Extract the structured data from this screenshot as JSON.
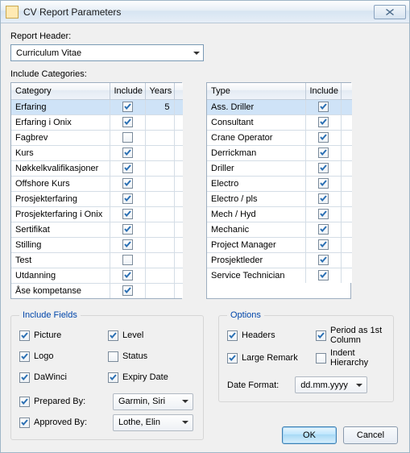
{
  "window": {
    "title": "CV Report Parameters"
  },
  "header": {
    "label": "Report Header:",
    "value": "Curriculum Vitae",
    "categories_label": "Include Categories:"
  },
  "left_table": {
    "cols": {
      "category": "Category",
      "include": "Include",
      "years": "Years"
    },
    "rows": [
      {
        "name": "Erfaring",
        "include": true,
        "years": "5",
        "selected": true
      },
      {
        "name": "Erfaring i Onix",
        "include": true,
        "years": ""
      },
      {
        "name": "Fagbrev",
        "include": false,
        "years": ""
      },
      {
        "name": "Kurs",
        "include": true,
        "years": ""
      },
      {
        "name": "Nøkkelkvalifikasjoner",
        "include": true,
        "years": ""
      },
      {
        "name": "Offshore Kurs",
        "include": true,
        "years": ""
      },
      {
        "name": "Prosjekterfaring",
        "include": true,
        "years": ""
      },
      {
        "name": "Prosjekterfaring i Onix",
        "include": true,
        "years": ""
      },
      {
        "name": "Sertifikat",
        "include": true,
        "years": ""
      },
      {
        "name": "Stilling",
        "include": true,
        "years": ""
      },
      {
        "name": "Test",
        "include": false,
        "years": ""
      },
      {
        "name": "Utdanning",
        "include": true,
        "years": ""
      },
      {
        "name": "Åse kompetanse",
        "include": true,
        "years": ""
      }
    ]
  },
  "right_table": {
    "cols": {
      "type": "Type",
      "include": "Include"
    },
    "rows": [
      {
        "name": "Ass. Driller",
        "include": true,
        "selected": true
      },
      {
        "name": "Consultant",
        "include": true
      },
      {
        "name": "Crane Operator",
        "include": true
      },
      {
        "name": "Derrickman",
        "include": true
      },
      {
        "name": "Driller",
        "include": true
      },
      {
        "name": "Electro",
        "include": true
      },
      {
        "name": "Electro / pls",
        "include": true
      },
      {
        "name": "Mech / Hyd",
        "include": true
      },
      {
        "name": "Mechanic",
        "include": true
      },
      {
        "name": "Project Manager",
        "include": true
      },
      {
        "name": "Prosjektleder",
        "include": true
      },
      {
        "name": "Service Technician",
        "include": true
      }
    ]
  },
  "fields": {
    "legend": "Include Fields",
    "items": {
      "picture": {
        "label": "Picture",
        "checked": true
      },
      "level": {
        "label": "Level",
        "checked": true
      },
      "logo": {
        "label": "Logo",
        "checked": true
      },
      "status": {
        "label": "Status",
        "checked": false
      },
      "dawinci": {
        "label": "DaWinci",
        "checked": true
      },
      "expiry": {
        "label": "Expiry Date",
        "checked": true
      },
      "prepared": {
        "label": "Prepared By:",
        "checked": true,
        "value": "Garmin, Siri"
      },
      "approved": {
        "label": "Approved By:",
        "checked": true,
        "value": "Lothe, Elin"
      }
    }
  },
  "options": {
    "legend": "Options",
    "headers": {
      "label": "Headers",
      "checked": true
    },
    "period": {
      "label": "Period as 1st Column",
      "checked": true
    },
    "large_remark": {
      "label": "Large Remark",
      "checked": true
    },
    "indent": {
      "label": "Indent Hierarchy",
      "checked": false
    },
    "date_format_label": "Date Format:",
    "date_format_value": "dd.mm.yyyy"
  },
  "buttons": {
    "ok": "OK",
    "cancel": "Cancel"
  }
}
